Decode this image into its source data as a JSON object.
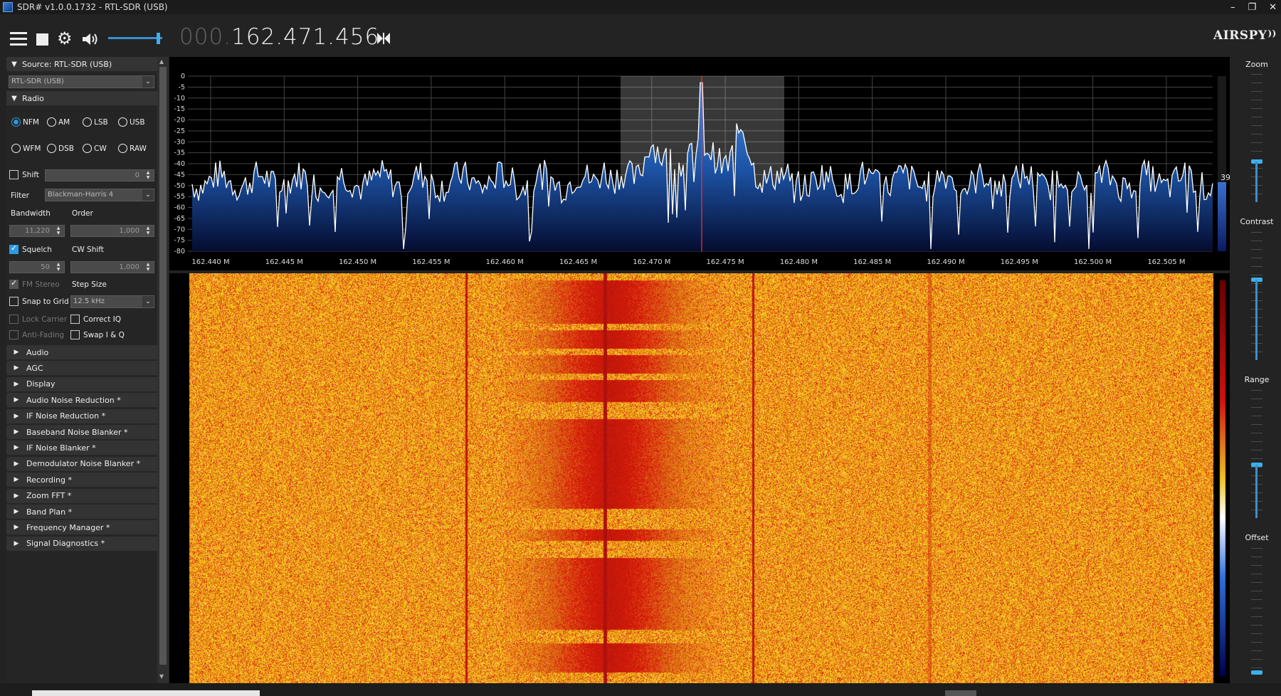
{
  "window": {
    "title": "SDR# v1.0.0.1732 - RTL-SDR (USB)",
    "controls": [
      "–",
      "❐",
      "✕"
    ]
  },
  "toolbar": {
    "freq_prefix": "000.",
    "freq_main": "162.471.456",
    "logo": "AIRSPY",
    "volume_level": 0.9
  },
  "source": {
    "header": "Source: RTL-SDR (USB)",
    "device": "RTL-SDR (USB)"
  },
  "radio": {
    "header": "Radio",
    "modes_row1": [
      "NFM",
      "AM",
      "LSB",
      "USB"
    ],
    "modes_row2": [
      "WFM",
      "DSB",
      "CW",
      "RAW"
    ],
    "selected_mode": "NFM",
    "shift_label": "Shift",
    "shift_value": "0",
    "filter_label": "Filter",
    "filter_value": "Blackman-Harris 4",
    "bandwidth_label": "Bandwidth",
    "bandwidth_value": "11,220",
    "order_label": "Order",
    "order_value": "1,000",
    "squelch_label": "Squelch",
    "squelch_value": "50",
    "cw_shift_label": "CW Shift",
    "cw_shift_value": "1,000",
    "fm_stereo_label": "FM Stereo",
    "step_size_label": "Step Size",
    "snap_label": "Snap to Grid",
    "step_size_value": "12.5 kHz",
    "lock_carrier_label": "Lock Carrier",
    "correct_iq_label": "Correct IQ",
    "anti_fading_label": "Anti-Fading",
    "swap_iq_label": "Swap I & Q"
  },
  "plugins": [
    "Audio",
    "AGC",
    "Display",
    "Audio Noise Reduction *",
    "IF Noise Reduction *",
    "Baseband Noise Blanker *",
    "IF Noise Blanker *",
    "Demodulator Noise Blanker *",
    "Recording *",
    "Zoom FFT *",
    "Band Plan *",
    "Frequency Manager *",
    "Signal Diagnostics *"
  ],
  "right_panel": {
    "zoom_label": "Zoom",
    "contrast_label": "Contrast",
    "range_label": "Range",
    "offset_label": "Offset",
    "snr_value": "39"
  },
  "spectrum": {
    "db_ticks": [
      "0",
      "-5",
      "-10",
      "-15",
      "-20",
      "-25",
      "-30",
      "-35",
      "-40",
      "-45",
      "-50",
      "-55",
      "-60",
      "-65",
      "-70",
      "-75",
      "-80"
    ],
    "freq_ticks": [
      "162.440 M",
      "162.445 M",
      "162.450 M",
      "162.455 M",
      "162.460 M",
      "162.465 M",
      "162.470 M",
      "162.475 M",
      "162.480 M",
      "162.485 M",
      "162.490 M",
      "162.495 M",
      "162.500 M",
      "162.505 M"
    ],
    "colors": {
      "fill": "#1f5fb0",
      "line": "#ffffff",
      "carrier": "#ff3030"
    }
  }
}
